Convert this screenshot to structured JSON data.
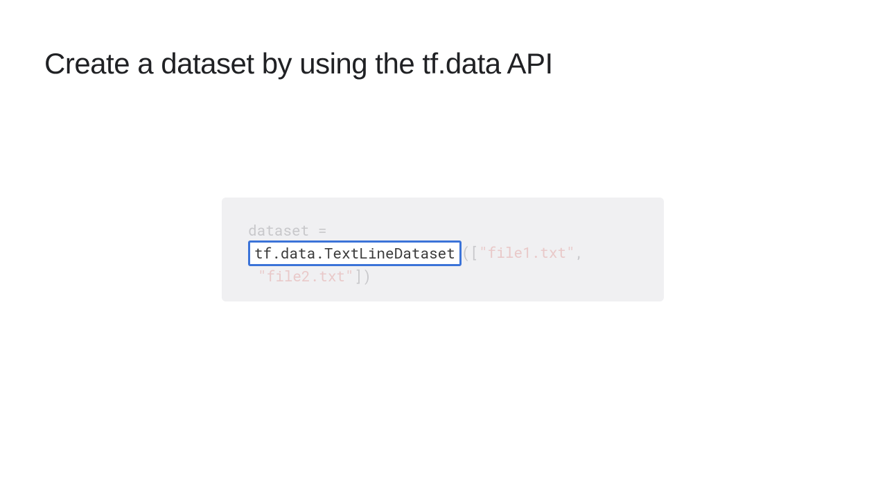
{
  "title": "Create a dataset by using the tf.data API",
  "code": {
    "line1_pre": "dataset =",
    "highlighted": "tf.data.TextLineDataset",
    "line2_after_open": "([",
    "file1": "\"file1.txt\"",
    "line2_comma": ",",
    "file2": "\"file2.txt\"",
    "line3_close": "])"
  }
}
